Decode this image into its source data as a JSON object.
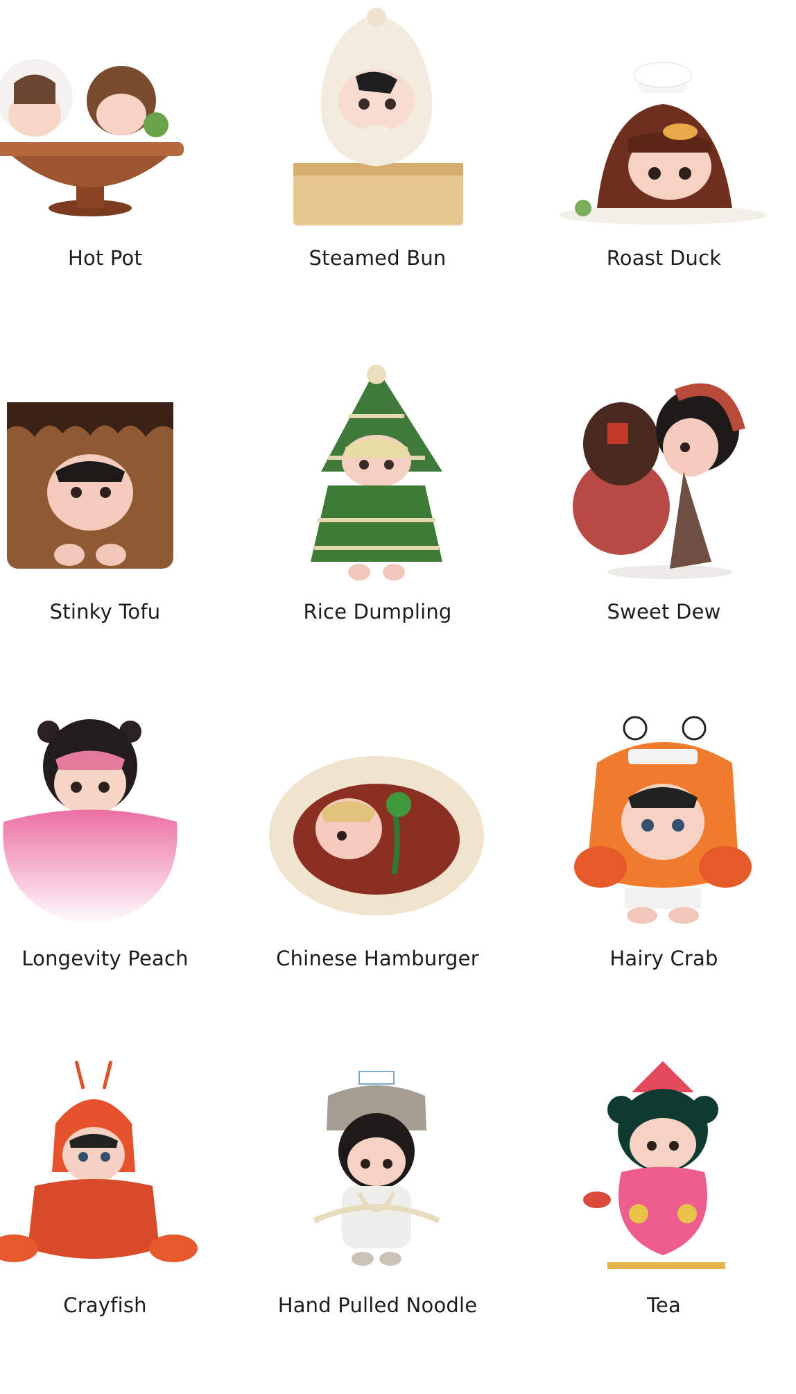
{
  "figures": [
    {
      "label": "Hot Pot"
    },
    {
      "label": "Steamed Bun"
    },
    {
      "label": "Roast Duck"
    },
    {
      "label": "Stinky Tofu"
    },
    {
      "label": "Rice Dumpling"
    },
    {
      "label": "Sweet Dew"
    },
    {
      "label": "Longevity Peach"
    },
    {
      "label": "Chinese Hamburger"
    },
    {
      "label": "Hairy Crab"
    },
    {
      "label": "Crayfish"
    },
    {
      "label": "Hand Pulled Noodle"
    },
    {
      "label": "Tea"
    }
  ]
}
